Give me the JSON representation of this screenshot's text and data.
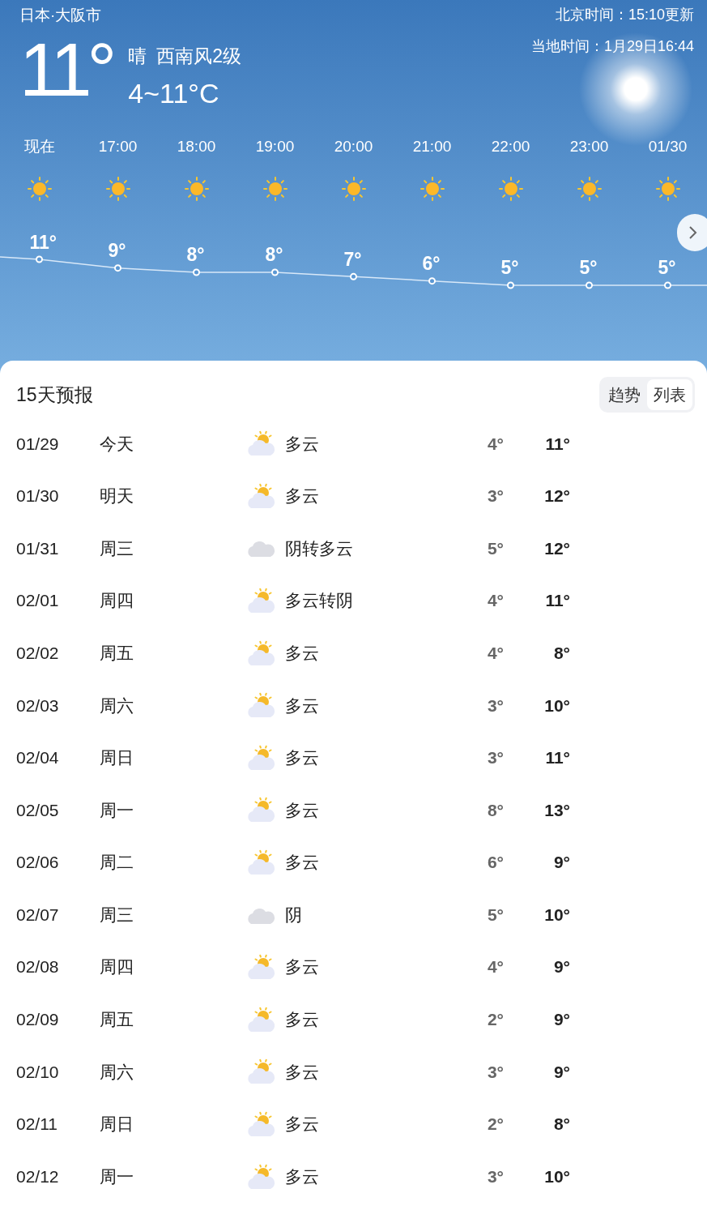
{
  "header": {
    "location": "日本·大阪市",
    "update_time": "北京时间：15:10更新",
    "local_time": "当地时间：1月29日16:44",
    "temperature": "11°",
    "condition": "晴",
    "wind": "西南风2级",
    "range": "4~11°C"
  },
  "hourly": [
    {
      "time": "现在",
      "temp": "11°"
    },
    {
      "time": "17:00",
      "temp": "9°"
    },
    {
      "time": "18:00",
      "temp": "8°"
    },
    {
      "time": "19:00",
      "temp": "8°"
    },
    {
      "time": "20:00",
      "temp": "7°"
    },
    {
      "time": "21:00",
      "temp": "6°"
    },
    {
      "time": "22:00",
      "temp": "5°"
    },
    {
      "time": "23:00",
      "temp": "5°"
    },
    {
      "time": "01/30",
      "temp": "5°"
    }
  ],
  "forecast": {
    "title": "15天预报",
    "toggle": [
      {
        "label": "趋势",
        "selected": false
      },
      {
        "label": "列表",
        "selected": true
      }
    ],
    "days": [
      {
        "date": "01/29",
        "day": "今天",
        "kind": "partly",
        "weather": "多云",
        "low": "4°",
        "high": "11°"
      },
      {
        "date": "01/30",
        "day": "明天",
        "kind": "partly",
        "weather": "多云",
        "low": "3°",
        "high": "12°"
      },
      {
        "date": "01/31",
        "day": "周三",
        "kind": "cloudy",
        "weather": "阴转多云",
        "low": "5°",
        "high": "12°"
      },
      {
        "date": "02/01",
        "day": "周四",
        "kind": "partly",
        "weather": "多云转阴",
        "low": "4°",
        "high": "11°"
      },
      {
        "date": "02/02",
        "day": "周五",
        "kind": "partly",
        "weather": "多云",
        "low": "4°",
        "high": "8°"
      },
      {
        "date": "02/03",
        "day": "周六",
        "kind": "partly",
        "weather": "多云",
        "low": "3°",
        "high": "10°"
      },
      {
        "date": "02/04",
        "day": "周日",
        "kind": "partly",
        "weather": "多云",
        "low": "3°",
        "high": "11°"
      },
      {
        "date": "02/05",
        "day": "周一",
        "kind": "partly",
        "weather": "多云",
        "low": "8°",
        "high": "13°"
      },
      {
        "date": "02/06",
        "day": "周二",
        "kind": "partly",
        "weather": "多云",
        "low": "6°",
        "high": "9°"
      },
      {
        "date": "02/07",
        "day": "周三",
        "kind": "cloudy",
        "weather": "阴",
        "low": "5°",
        "high": "10°"
      },
      {
        "date": "02/08",
        "day": "周四",
        "kind": "partly",
        "weather": "多云",
        "low": "4°",
        "high": "9°"
      },
      {
        "date": "02/09",
        "day": "周五",
        "kind": "partly",
        "weather": "多云",
        "low": "2°",
        "high": "9°"
      },
      {
        "date": "02/10",
        "day": "周六",
        "kind": "partly",
        "weather": "多云",
        "low": "3°",
        "high": "9°"
      },
      {
        "date": "02/11",
        "day": "周日",
        "kind": "partly",
        "weather": "多云",
        "low": "2°",
        "high": "8°"
      },
      {
        "date": "02/12",
        "day": "周一",
        "kind": "partly",
        "weather": "多云",
        "low": "3°",
        "high": "10°"
      }
    ]
  }
}
